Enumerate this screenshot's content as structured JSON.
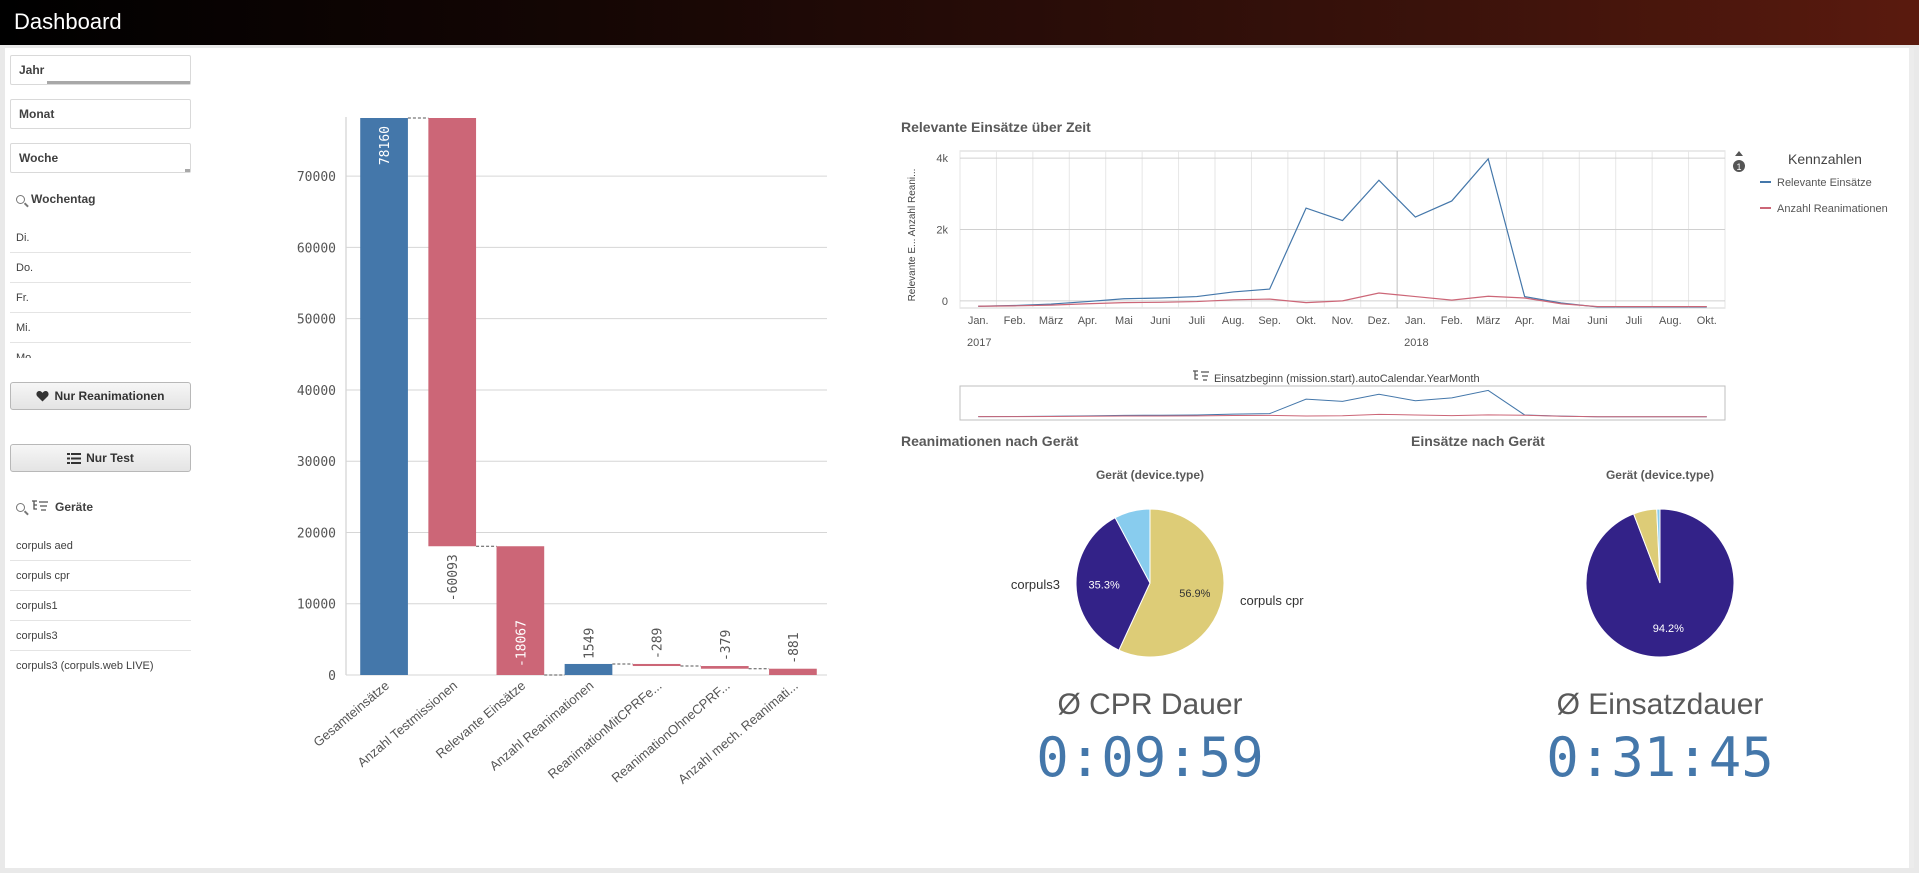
{
  "app": {
    "title": "Dashboard"
  },
  "filters": {
    "jahr": "Jahr",
    "monat": "Monat",
    "woche": "Woche"
  },
  "wochentag": {
    "title": "Wochentag",
    "items": [
      "Di.",
      "Do.",
      "Fr.",
      "Mi.",
      "Mo."
    ]
  },
  "buttons": {
    "nur_reanimationen": "Nur Reanimationen",
    "nur_test": "Nur Test"
  },
  "geraete": {
    "title": "Geräte",
    "items": [
      "corpuls aed",
      "corpuls cpr",
      "corpuls1",
      "corpuls3",
      "corpuls3 (corpuls.web LIVE)"
    ]
  },
  "colors": {
    "blue": "#4477aa",
    "red": "#cc6677",
    "navy": "#332288",
    "yellow": "#ddcc77",
    "cyan": "#88ccee"
  },
  "chart_data": [
    {
      "type": "bar",
      "subtype": "waterfall",
      "categories": [
        "Gesamteinsätze",
        "Anzahl Testmissionen",
        "Relevante Einsätze",
        "Anzahl Reanimationen",
        "ReanimationMitCPRFe...",
        "ReanimationOhneCPRF...",
        "Anzahl mech. Reanimati..."
      ],
      "values": [
        78160,
        -60093,
        -18067,
        1549,
        -289,
        -379,
        -881
      ],
      "value_labels": [
        "78160",
        "-60093",
        "-18067",
        "1549",
        "-289",
        "-379",
        "-881"
      ],
      "bar_colors": [
        "#4477aa",
        "#cc6677",
        "#cc6677",
        "#4477aa",
        "#cc6677",
        "#cc6677",
        "#cc6677"
      ],
      "bar_ranges": [
        [
          0,
          78160
        ],
        [
          18067,
          78160
        ],
        [
          0,
          18067
        ],
        [
          0,
          1549
        ],
        [
          1260,
          1549
        ],
        [
          881,
          1260
        ],
        [
          0,
          881
        ]
      ],
      "ylim": [
        0,
        78160
      ],
      "yticks": [
        "0",
        "10000",
        "20000",
        "30000",
        "40000",
        "50000",
        "60000",
        "70000"
      ],
      "grid": true
    },
    {
      "type": "line",
      "title": "Relevante Einsätze über Zeit",
      "ylabel": "Relevante E... Anzahl Reani...",
      "xlabel": "Einsatzbeginn (mission.start).autoCalendar.YearMonth",
      "x": [
        "Jan.",
        "Feb.",
        "März",
        "Apr.",
        "Mai",
        "Juni",
        "Juli",
        "Aug.",
        "Sep.",
        "Okt.",
        "Nov.",
        "Dez.",
        "Jan.",
        "Feb.",
        "März",
        "Apr.",
        "Mai",
        "Juni",
        "Juli",
        "Aug.",
        "Okt."
      ],
      "years": [
        "2017",
        "2018"
      ],
      "yticks": [
        "0",
        "2k",
        "4k"
      ],
      "ylim": [
        -200,
        4200
      ],
      "legend_title": "Kennzahlen",
      "legend_position": "right",
      "legend_badge": "1",
      "series": [
        {
          "name": "Relevante Einsätze",
          "color": "#4477aa",
          "values": [
            -150,
            -130,
            -90,
            -20,
            60,
            80,
            120,
            250,
            330,
            2600,
            2250,
            3380,
            2350,
            2800,
            3980,
            120,
            -60,
            -170,
            -170,
            -170,
            -170
          ]
        },
        {
          "name": "Anzahl Reanimationen",
          "color": "#cc6677",
          "values": [
            -150,
            -140,
            -120,
            -80,
            -50,
            -40,
            -20,
            30,
            50,
            -50,
            0,
            220,
            120,
            20,
            130,
            80,
            -80,
            -160,
            -160,
            -160,
            -160
          ]
        }
      ],
      "grid": true
    },
    {
      "type": "pie",
      "title": "Reanimationen nach Gerät",
      "subtitle": "Gerät (device.type)",
      "slices": [
        {
          "name": "corpuls cpr",
          "value": 56.9,
          "label": "56.9%",
          "color": "#ddcc77"
        },
        {
          "name": "corpuls3",
          "value": 35.3,
          "label": "35.3%",
          "color": "#332288"
        },
        {
          "name": "",
          "value": 7.8,
          "label": "",
          "color": "#88ccee"
        }
      ]
    },
    {
      "type": "pie",
      "title": "Einsätze nach Gerät",
      "subtitle": "Gerät (device.type)",
      "slices": [
        {
          "name": "",
          "value": 94.2,
          "label": "94.2%",
          "color": "#332288"
        },
        {
          "name": "",
          "value": 5.1,
          "label": "",
          "color": "#ddcc77"
        },
        {
          "name": "",
          "value": 0.7,
          "label": "",
          "color": "#88ccee"
        }
      ]
    }
  ],
  "kpis": {
    "cpr": {
      "label": "Ø CPR Dauer",
      "value": "0:09:59"
    },
    "einsatz": {
      "label": "Ø Einsatzdauer",
      "value": "0:31:45"
    }
  }
}
